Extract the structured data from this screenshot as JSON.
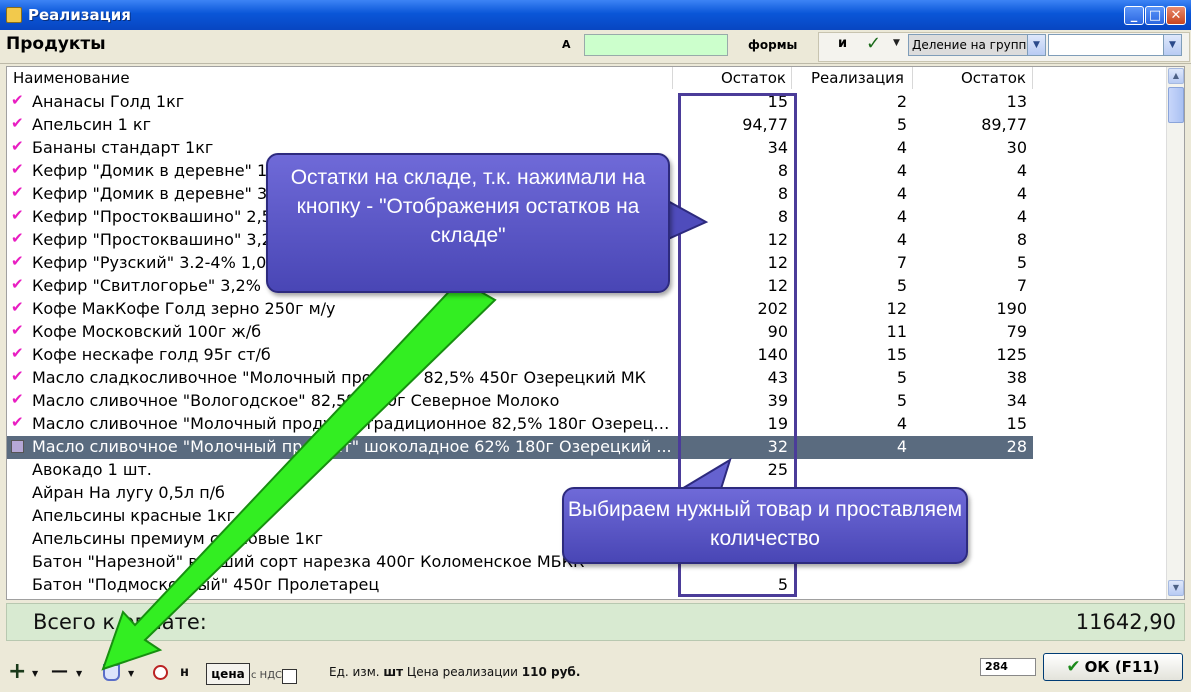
{
  "window": {
    "title": "Реализация",
    "minimize": "_",
    "maximize": "□",
    "close": "✕"
  },
  "toolbar": {
    "section_title": "Продукты",
    "search_label": "А",
    "search_value": "",
    "forms_label": "формы",
    "and_label": "и",
    "check_label": "✓",
    "group_select": "Деление на групп",
    "second_select": ""
  },
  "grid": {
    "headers": {
      "name": "Наименование",
      "stock": "Остаток",
      "sales": "Реализация",
      "rest": "Остаток"
    },
    "rows": [
      {
        "name": "Ананасы Голд 1кг",
        "stock": "15",
        "sales": "2",
        "rest": "13",
        "checked": true
      },
      {
        "name": "Апельсин 1 кг",
        "stock": "94,77",
        "sales": "5",
        "rest": "89,77",
        "checked": true
      },
      {
        "name": "Бананы стандарт 1кг",
        "stock": "34",
        "sales": "4",
        "rest": "30",
        "checked": true
      },
      {
        "name": "Кефир \"Домик в деревне\" 1,",
        "stock": "8",
        "sales": "4",
        "rest": "4",
        "checked": true
      },
      {
        "name": "Кефир \"Домик в деревне\" 3,",
        "stock": "8",
        "sales": "4",
        "rest": "4",
        "checked": true
      },
      {
        "name": "Кефир \"Простоквашино\" 2,5",
        "stock": "8",
        "sales": "4",
        "rest": "4",
        "checked": true
      },
      {
        "name": "Кефир \"Простоквашино\" 3,2",
        "stock": "12",
        "sales": "4",
        "rest": "8",
        "checked": true
      },
      {
        "name": "Кефир \"Рузский\" 3.2-4% 1,0",
        "stock": "12",
        "sales": "7",
        "rest": "5",
        "checked": true
      },
      {
        "name": "Кефир \"Свитлогорье\" 3,2%",
        "stock": "12",
        "sales": "5",
        "rest": "7",
        "checked": true
      },
      {
        "name": "Кофе МакКофе Голд зерно 250г м/у",
        "stock": "202",
        "sales": "12",
        "rest": "190",
        "checked": true
      },
      {
        "name": "Кофе Московский 100г ж/б",
        "stock": "90",
        "sales": "11",
        "rest": "79",
        "checked": true
      },
      {
        "name": "Кофе нескафе голд 95г ст/б",
        "stock": "140",
        "sales": "15",
        "rest": "125",
        "checked": true
      },
      {
        "name": "Масло сладкосливочное \"Молочный продукт\" 82,5% 450г Озерецкий МК",
        "stock": "43",
        "sales": "5",
        "rest": "38",
        "checked": true
      },
      {
        "name": "Масло сливочное \"Вологодское\" 82,5% 180г Северное Молоко",
        "stock": "39",
        "sales": "5",
        "rest": "34",
        "checked": true
      },
      {
        "name": "Масло сливочное \"Молочный продукт\" традиционное 82,5% 180г Озерецк...",
        "stock": "19",
        "sales": "4",
        "rest": "15",
        "checked": true
      },
      {
        "name": "Масло сливочное \"Молочный продукт\" шоколадное 62% 180г Озерецкий ...",
        "stock": "32",
        "sales": "4",
        "rest": "28",
        "checked": false,
        "selected": true
      },
      {
        "name": "Авокадо 1 шт.",
        "stock": "25",
        "sales": "",
        "rest": "",
        "checked": false
      },
      {
        "name": "Айран На лугу 0,5л п/б",
        "stock": "",
        "sales": "",
        "rest": "",
        "checked": false
      },
      {
        "name": "Апельсины красные 1кг",
        "stock": "",
        "sales": "",
        "rest": "",
        "checked": false
      },
      {
        "name": "Апельсины премиум столовые 1кг",
        "stock": "",
        "sales": "",
        "rest": "",
        "checked": false
      },
      {
        "name": "Батон \"Нарезной\" высший сорт нарезка 400г Коломенское МБКК",
        "stock": "",
        "sales": "",
        "rest": "",
        "checked": false
      },
      {
        "name": "Батон \"Подмосковный\" 450г Пролетарец",
        "stock": "5",
        "sales": "",
        "rest": "",
        "checked": false
      }
    ]
  },
  "total": {
    "label": "Всего к оплате:",
    "value": "11642,90"
  },
  "bottombar": {
    "add_icon": "+",
    "remove_icon": "—",
    "n_label": "н",
    "price_button": "цена",
    "nds_label": "с НДС",
    "unit_label": "Ед. изм.",
    "unit_value": "шт",
    "price_label": "Цена реализации",
    "price_value": "110 руб.",
    "code": "284",
    "ok_button": "ОК  (F11)"
  },
  "callouts": {
    "stock_note": "Остатки на складе, т.к. нажимали на кнопку - \"Отображения остатков на складе\"",
    "select_note": "Выбираем нужный товар и проставляем количество"
  },
  "colors": {
    "accent": "#4946b5",
    "selected_row": "#5a6b7f",
    "search_bg": "#ccffcc",
    "total_bg": "#d8ead1",
    "arrow": "#33ee22",
    "checkmark": "#e91ec2"
  }
}
